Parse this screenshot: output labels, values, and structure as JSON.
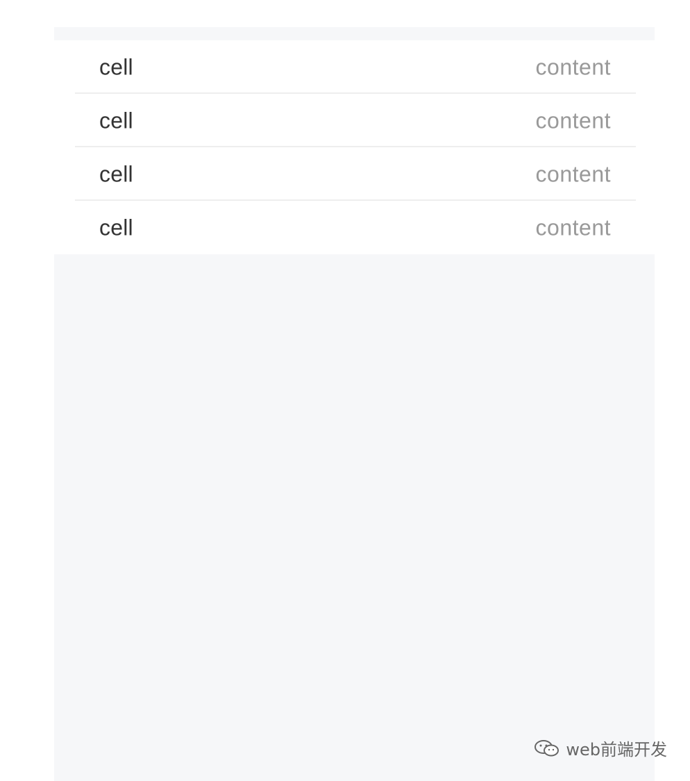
{
  "cells": [
    {
      "title": "cell",
      "value": "content"
    },
    {
      "title": "cell",
      "value": "content"
    },
    {
      "title": "cell",
      "value": "content"
    },
    {
      "title": "cell",
      "value": "content"
    }
  ],
  "watermark": {
    "text": "web前端开发",
    "icon": "wechat-icon"
  },
  "colors": {
    "background": "#f6f7f9",
    "cell_background": "#ffffff",
    "title": "#333333",
    "value": "#999999",
    "divider": "#eeeeee"
  }
}
